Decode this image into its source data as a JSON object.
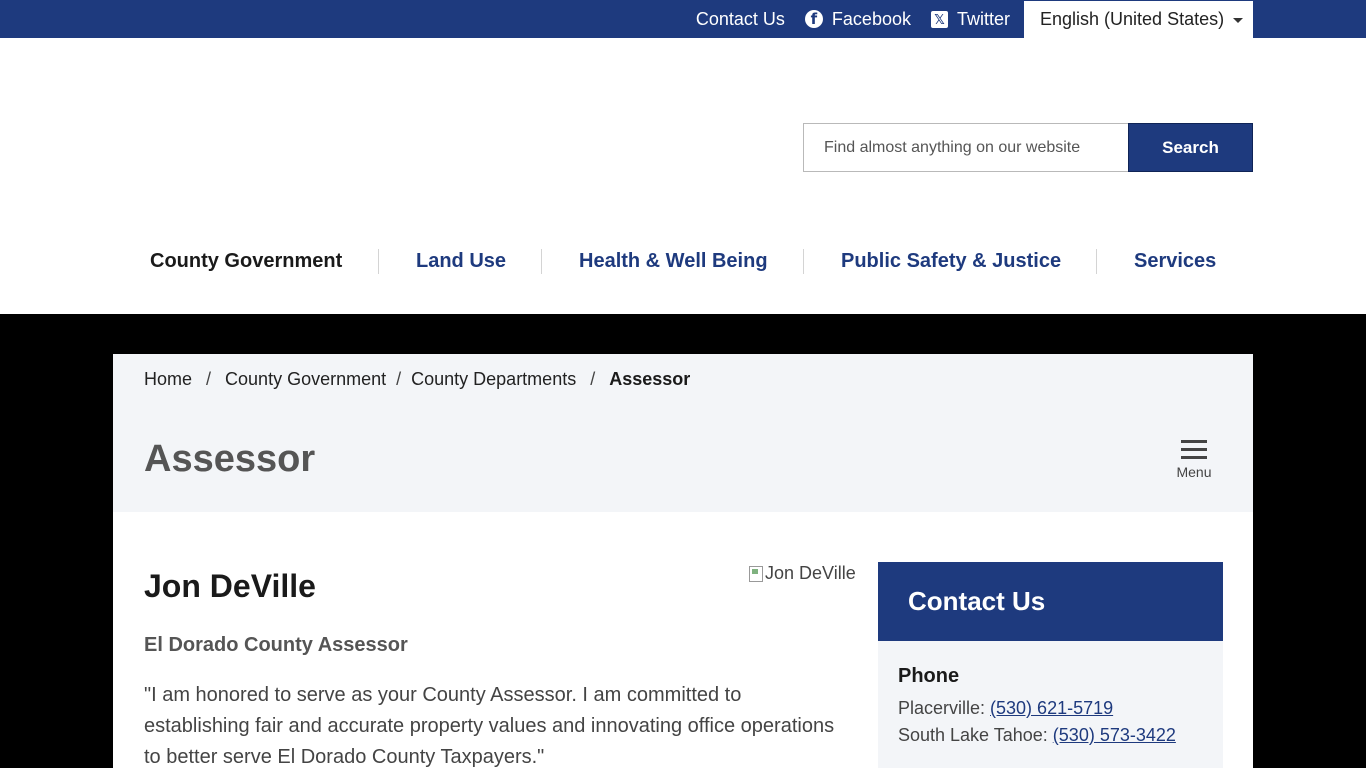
{
  "topbar": {
    "contact_label": "Contact Us",
    "facebook_label": "Facebook",
    "twitter_label": "Twitter",
    "language": "English (United States)"
  },
  "search": {
    "placeholder": "Find almost anything on our website",
    "button_label": "Search"
  },
  "nav": {
    "items": [
      {
        "label": "County Government"
      },
      {
        "label": "Land Use"
      },
      {
        "label": "Health & Well Being"
      },
      {
        "label": "Public Safety & Justice"
      },
      {
        "label": "Services"
      }
    ]
  },
  "breadcrumb": {
    "home": "Home",
    "level1": "County Government",
    "level2": "County Departments",
    "current": "Assessor"
  },
  "page": {
    "title": "Assessor",
    "menu_label": "Menu"
  },
  "profile": {
    "name": "Jon DeVille",
    "image_alt": "Jon DeVille",
    "role": "El Dorado County Assessor",
    "quote": "\"I am honored to serve as your County Assessor. I am committed to establishing fair and accurate property values and innovating office operations to better serve El Dorado County Taxpayers.\""
  },
  "contact": {
    "title": "Contact Us",
    "phone_title": "Phone",
    "placerville_label": "Placerville: ",
    "placerville_number": "(530) 621-5719",
    "tahoe_label": "South Lake Tahoe: ",
    "tahoe_number": "(530) 573-3422"
  },
  "colors": {
    "brand_blue": "#1e3a7e",
    "panel_gray": "#f3f5f8"
  }
}
